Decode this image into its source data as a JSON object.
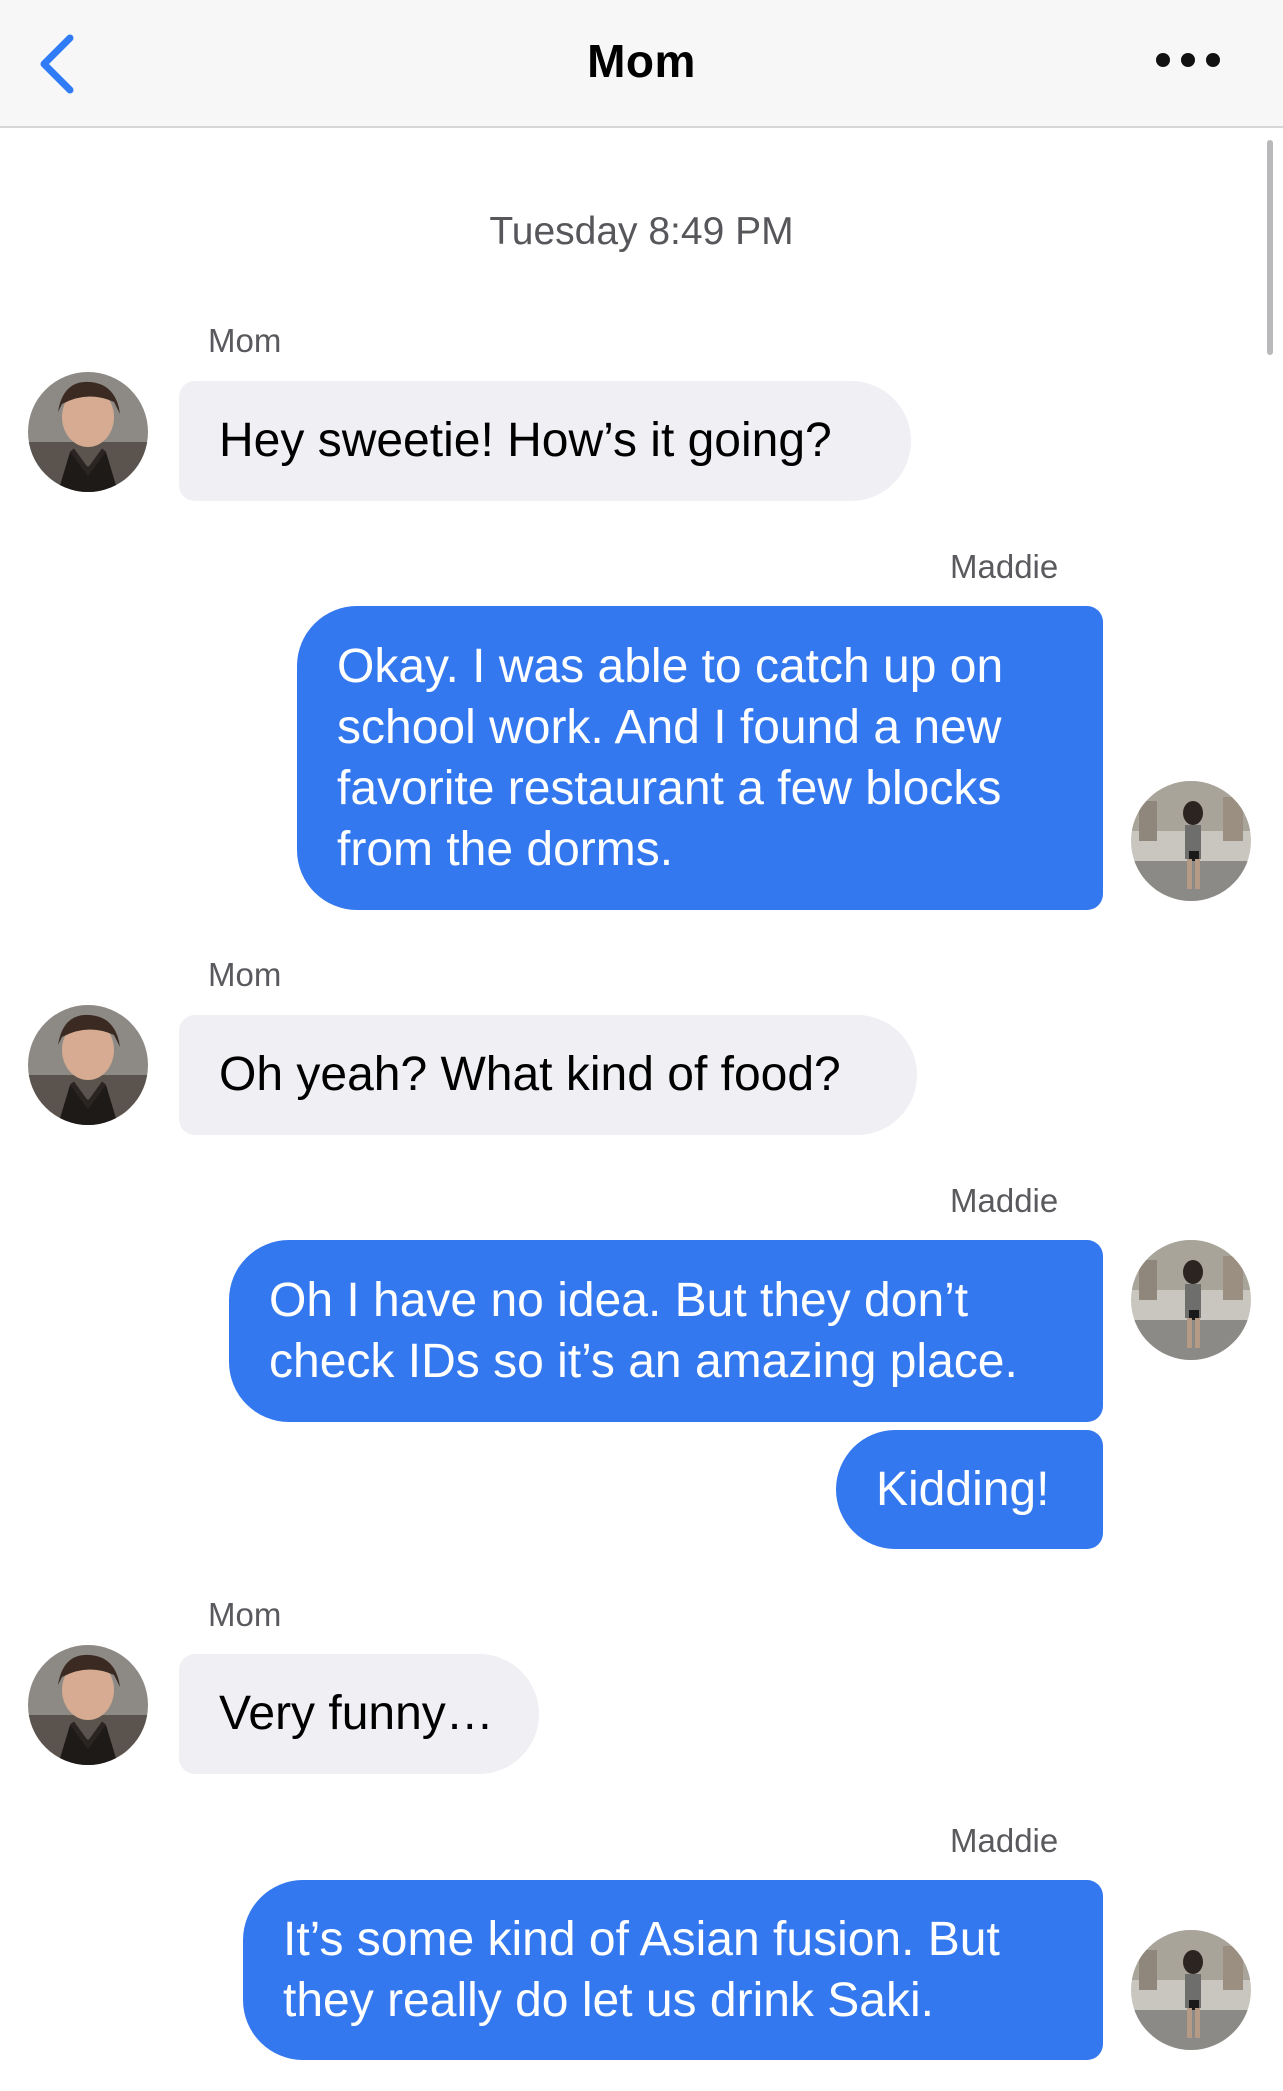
{
  "nav": {
    "title": "Mom",
    "back_icon": "chevron-left-icon",
    "more_icon": "ellipsis-icon"
  },
  "timestamp": "Tuesday 8:49 PM",
  "colors": {
    "outgoing_bubble": "#3478f0",
    "incoming_bubble": "#efeff4",
    "accent": "#2f7cf6"
  },
  "messages": [
    {
      "sender": "Mom",
      "text": "Hey sweetie! How’s it going?"
    },
    {
      "sender": "Maddie",
      "text": "Okay. I was able to catch up on school work. And I found a new favorite restaurant a few blocks from the dorms."
    },
    {
      "sender": "Mom",
      "text": "Oh yeah? What kind of food?"
    },
    {
      "sender": "Maddie",
      "text": "Oh I have no idea. But they don’t check IDs so it’s an amazing place."
    },
    {
      "sender": "Maddie",
      "text": "Kidding!"
    },
    {
      "sender": "Mom",
      "text": "Very funny…"
    },
    {
      "sender": "Maddie",
      "text": "It’s some kind of Asian fusion. But they really do let us drink Saki."
    }
  ]
}
